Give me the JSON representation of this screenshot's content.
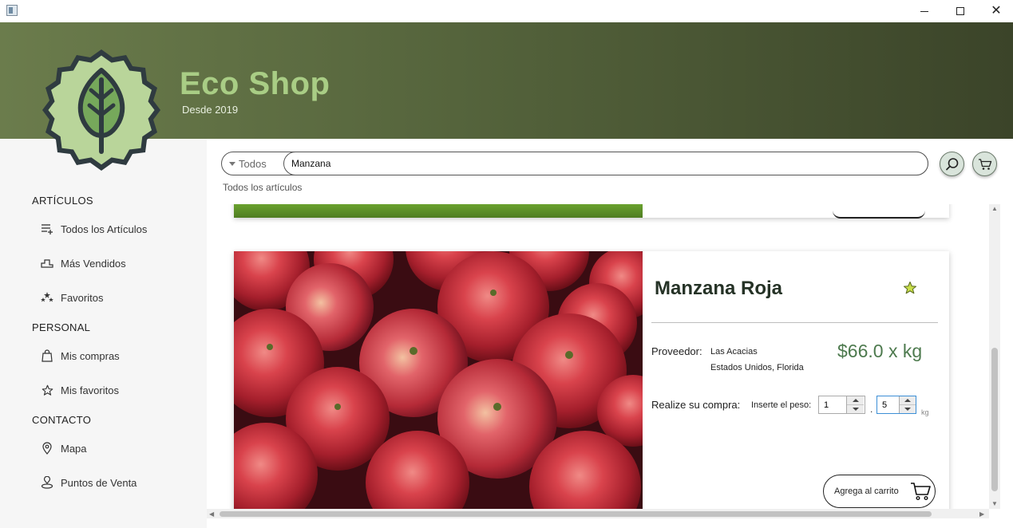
{
  "window": {
    "minimize_icon": "minimize-icon",
    "maximize_icon": "maximize-icon",
    "close_icon": "close-icon",
    "close_glyph": "✕"
  },
  "header": {
    "title": "Eco Shop",
    "subtitle": "Desde 2019",
    "logo": "leaf-badge-logo"
  },
  "colors": {
    "header_start": "#6b7c4c",
    "header_end": "#3b4429",
    "title": "#a9cd85",
    "price": "#4d7a4e",
    "sidebar_bg": "#f6f6f6"
  },
  "sidebar": {
    "sections": [
      {
        "title": "ARTÍCULOS",
        "items": [
          {
            "label": "Todos los Artículos",
            "icon": "list-add-icon"
          },
          {
            "label": "Más Vendidos",
            "icon": "podium-icon"
          },
          {
            "label": "Favoritos",
            "icon": "stars-icon"
          }
        ]
      },
      {
        "title": "PERSONAL",
        "items": [
          {
            "label": "Mis compras",
            "icon": "shopping-bag-icon"
          },
          {
            "label": "Mis favoritos",
            "icon": "star-icon"
          }
        ]
      },
      {
        "title": "CONTACTO",
        "items": [
          {
            "label": "Mapa",
            "icon": "location-pin-icon"
          },
          {
            "label": "Puntos de Venta",
            "icon": "store-location-icon"
          }
        ]
      }
    ]
  },
  "search": {
    "category": "Todos",
    "query": "Manzana",
    "search_icon": "search-icon",
    "cart_icon": "cart-icon",
    "breadcrumb": "Todos los artículos"
  },
  "product": {
    "name": "Manzana Roja",
    "favorite_icon": "star-icon",
    "provider_label": "Proveedor:",
    "provider_name": "Las Acacias",
    "provider_location": "Estados Unidos, Florida",
    "price": "$66.0 x kg",
    "buy_label": "Realize su compra:",
    "weight_label": "Inserte el peso:",
    "weight_integer": "1",
    "weight_decimal": "5",
    "decimal_separator": ".",
    "unit": "kg",
    "add_to_cart": "Agrega al carrito",
    "image": "red-apples-photo"
  }
}
